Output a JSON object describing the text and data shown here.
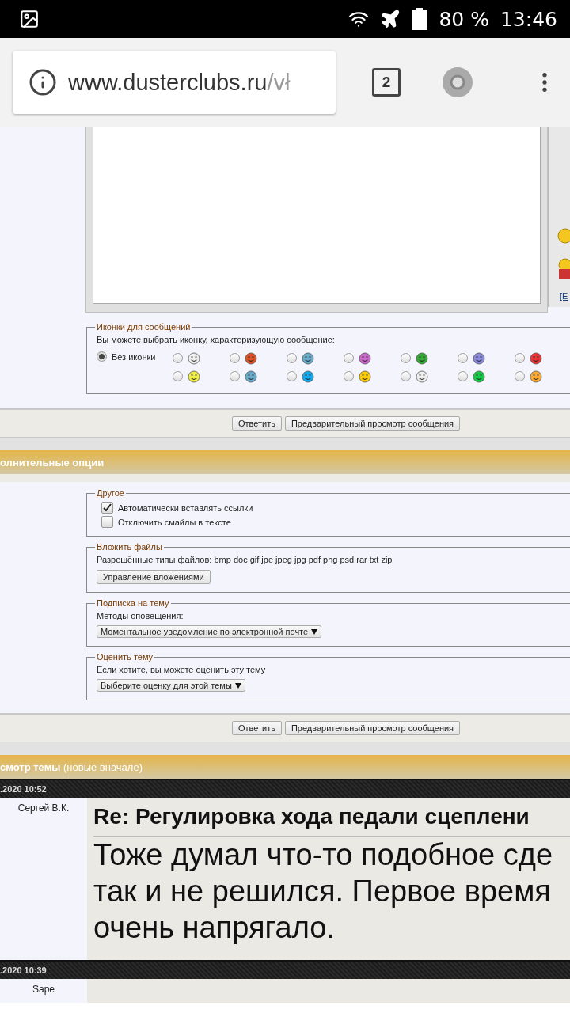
{
  "status_bar": {
    "battery": "80 %",
    "time": "13:46"
  },
  "browser": {
    "url_host": "www.dusterclubs.ru",
    "url_path": "/vł",
    "tab_count": "2"
  },
  "smilies_panel": {
    "link": "[Е"
  },
  "message_icons": {
    "legend": "Иконки для сообщений",
    "hint": "Вы можете выбрать иконку, характеризующую сообщение:",
    "none_option": {
      "label": "Без иконки",
      "selected": true
    },
    "options": [
      {
        "selected": false
      },
      {
        "selected": false
      },
      {
        "selected": false
      },
      {
        "selected": false
      },
      {
        "selected": false
      },
      {
        "selected": false
      },
      {
        "selected": false
      },
      {
        "selected": false
      },
      {
        "selected": false
      },
      {
        "selected": false
      },
      {
        "selected": false
      },
      {
        "selected": false
      },
      {
        "selected": false
      },
      {
        "selected": false
      }
    ]
  },
  "buttons_top": [
    "Ответить",
    "Предварительный просмотр сообщения"
  ],
  "options_header": "олнительные опции",
  "other": {
    "legend": "Другое",
    "checkboxes": [
      {
        "label": "Автоматически вставлять ссылки",
        "checked": true
      },
      {
        "label": "Отключить смайлы в тексте",
        "checked": false
      }
    ]
  },
  "attach": {
    "legend": "Вложить файлы",
    "allowed": "Разрешённые типы файлов: bmp doc gif jpe jpeg jpg pdf png psd rar txt zip",
    "button": "Управление вложениями"
  },
  "subscribe": {
    "legend": "Подписка на тему",
    "label": "Методы оповещения:",
    "value": "Моментальное уведомление по электронной почте"
  },
  "rate": {
    "legend": "Оценить тему",
    "label": "Если хотите, вы можете оценить эту тему",
    "value": "Выберите оценку для этой темы"
  },
  "buttons_bottom": [
    "Ответить",
    "Предварительный просмотр сообщения"
  ],
  "review_header": {
    "title": "смотр темы",
    "note": "(новые вначале)"
  },
  "posts": [
    {
      "date": ".2020 10:52",
      "author": "Сергей В.К.",
      "title": "Re: Регулировка хода педали сцеплени",
      "body_lines": [
        "Тоже думал что-то подобное сде",
        "так и не решился. Первое время",
        "очень напрягало."
      ]
    },
    {
      "date": ".2020 10:39",
      "author": "Sape"
    }
  ]
}
